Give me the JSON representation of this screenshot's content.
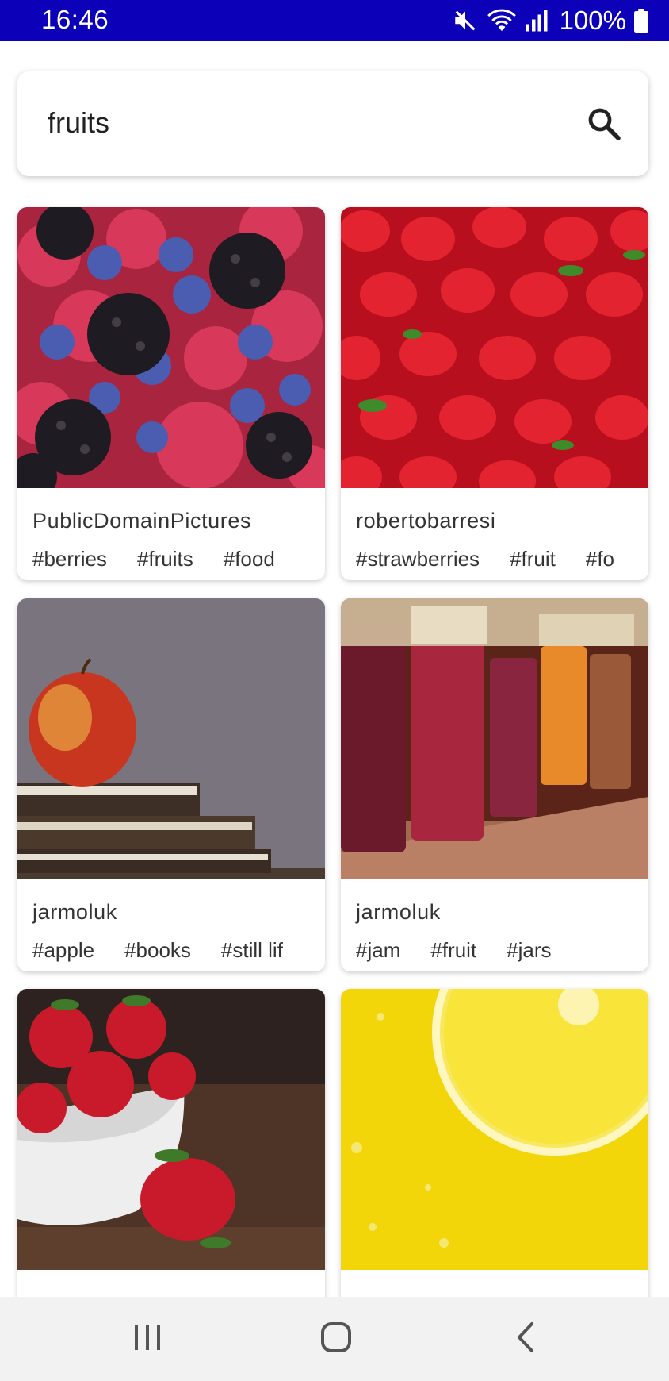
{
  "status_bar": {
    "time": "16:46",
    "battery_text": "100%",
    "icons": [
      "mute-icon",
      "wifi-icon",
      "signal-icon",
      "battery-icon"
    ]
  },
  "search": {
    "query": "fruits",
    "icon": "search-icon"
  },
  "results": [
    {
      "author": "PublicDomainPictures",
      "tags": [
        "#berries",
        "#fruits",
        "#food"
      ],
      "image": "mixed berries"
    },
    {
      "author": "robertobarresi",
      "tags": [
        "#strawberries",
        "#fruit",
        "#fo"
      ],
      "image": "strawberries pile"
    },
    {
      "author": "jarmoluk",
      "tags": [
        "#apple",
        "#books",
        "#still lif"
      ],
      "image": "apple on books"
    },
    {
      "author": "jarmoluk",
      "tags": [
        "#jam",
        "#fruit",
        "#jars"
      ],
      "image": "jam jars"
    },
    {
      "author": "",
      "tags": [],
      "image": "strawberries in bowl"
    },
    {
      "author": "",
      "tags": [],
      "image": "lemon slice in water"
    }
  ],
  "nav": {
    "buttons": [
      "recent-apps-icon",
      "home-icon",
      "back-icon"
    ]
  },
  "colors": {
    "status_bar": "#0c00b8",
    "nav_bar": "#f2f2f2"
  }
}
